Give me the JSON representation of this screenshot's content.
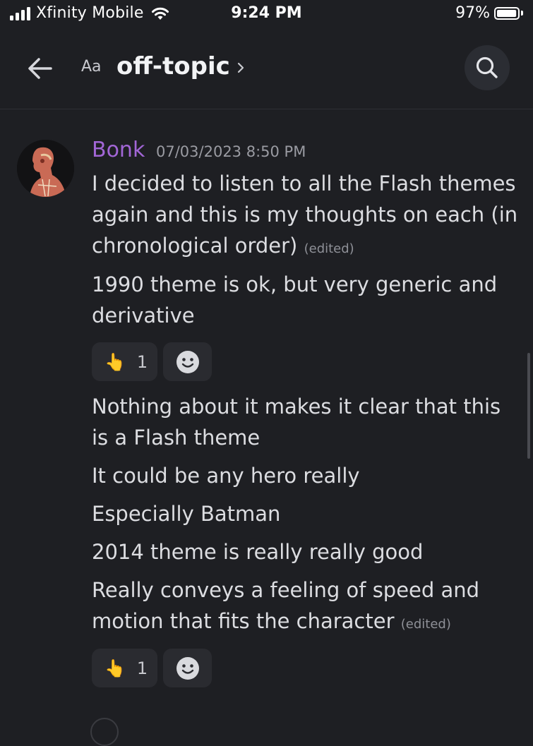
{
  "status_bar": {
    "carrier": "Xfinity Mobile",
    "time": "9:24 PM",
    "battery_percent_text": "97%",
    "battery_level": 0.97,
    "signal_bars": 4
  },
  "header": {
    "back_icon": "arrow-left-icon",
    "text_size_label": "Aa",
    "channel_name": "off-topic",
    "search_icon": "search-icon"
  },
  "message": {
    "username": "Bonk",
    "username_color": "#a266d6",
    "timestamp": "07/03/2023 8:50 PM",
    "lines": [
      {
        "text": "I decided to listen to all the Flash themes again and this is my thoughts on each (in chronological order)",
        "edited": "(edited)"
      },
      {
        "text": "1990 theme is ok, but very generic and derivative"
      },
      {
        "text": "Nothing about it makes it clear that this is a Flash theme"
      },
      {
        "text": "It could be any hero really"
      },
      {
        "text": "Especially Batman"
      },
      {
        "text": "2014 theme is really really good"
      },
      {
        "text": "Really conveys a feeling of speed and motion that fits the character",
        "edited": "(edited)"
      }
    ],
    "reactions_1": {
      "emoji": "👆",
      "count": "1"
    },
    "reactions_2": {
      "emoji": "👆",
      "count": "1"
    },
    "add_reaction_icon": "smiley-icon"
  }
}
